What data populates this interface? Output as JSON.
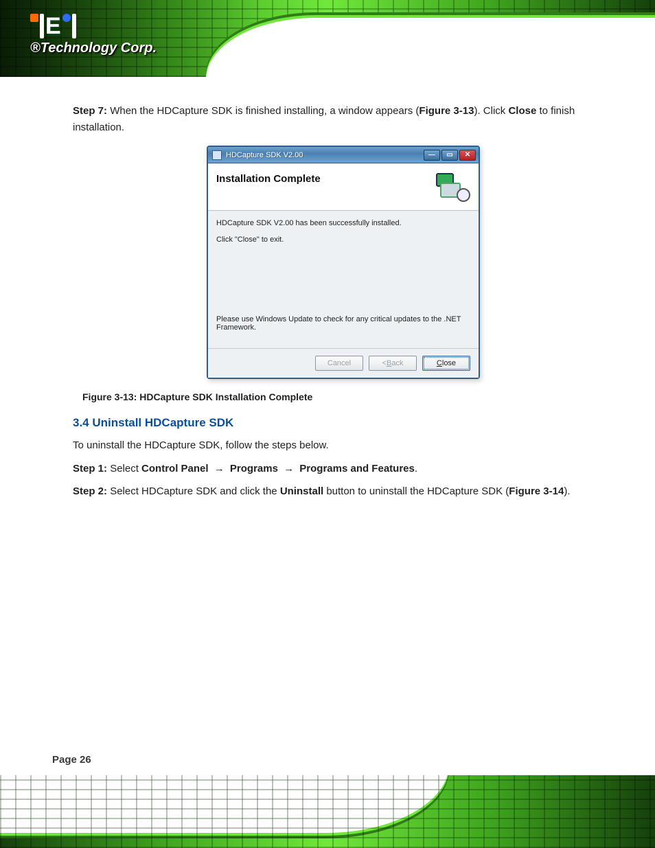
{
  "logo": {
    "subtitle": "®Technology Corp."
  },
  "step7": {
    "label": "Step 7:",
    "text_a": "When the HDCapture SDK is finished installing, a window appears (",
    "fig_ref": "Figure 3-13",
    "text_b": "). Click ",
    "btn": "Close",
    "text_c": " to finish installation."
  },
  "win": {
    "title": "HDCapture SDK V2.00",
    "heading": "Installation Complete",
    "line1": "HDCapture SDK V2.00 has been successfully installed.",
    "line2": "Click \"Close\" to exit.",
    "note": "Please use Windows Update to check for any critical updates to the .NET Framework.",
    "btn_cancel": "Cancel",
    "btn_back_pre": "< ",
    "btn_back_u": "B",
    "btn_back_post": "ack",
    "btn_close_u": "C",
    "btn_close_post": "lose"
  },
  "figure_caption": "Figure 3-13: HDCapture SDK Installation Complete",
  "section34": {
    "heading": "3.4 Uninstall HDCapture SDK",
    "p1": "To uninstall the HDCapture SDK, follow the steps below.",
    "step1_label": "Step 1:",
    "step1_a": "Select ",
    "step1_b": "Control Panel",
    "step1_c": "Programs",
    "step1_d": "Programs and Features",
    "step1_e": ".",
    "step2_label": "Step 2:",
    "step2_a": "Select HDCapture SDK and click the ",
    "step2_b": "Uninstall",
    "step2_c": " button to uninstall the HDCapture SDK (",
    "step2_fig": "Figure 3-14",
    "step2_d": ")."
  },
  "page_number": "Page 26"
}
